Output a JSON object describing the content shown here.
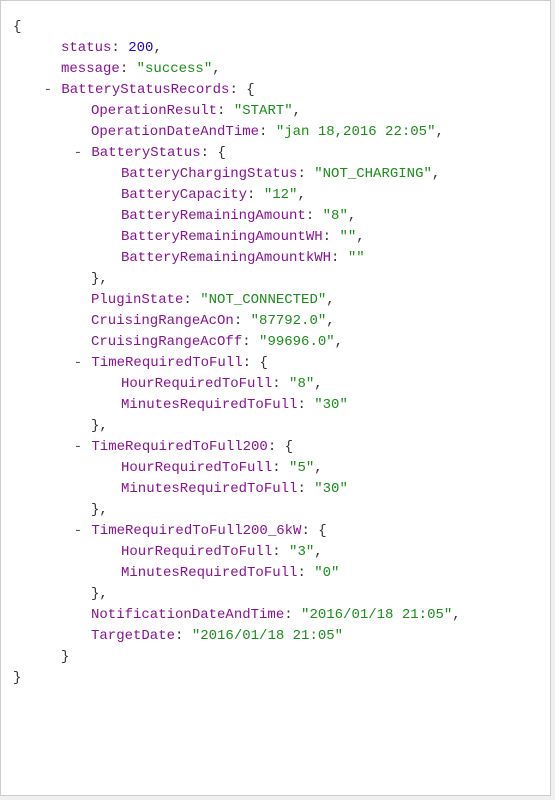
{
  "root": {
    "open": "{",
    "close": "}",
    "status_key": "status",
    "status_val": "200",
    "message_key": "message",
    "message_val": "\"success\"",
    "bsr_key": "BatteryStatusRecords",
    "bsr_open": "{",
    "op_result_key": "OperationResult",
    "op_result_val": "\"START\"",
    "op_dt_key": "OperationDateAndTime",
    "op_dt_val": "\"jan 18,2016 22:05\"",
    "bs_key": "BatteryStatus",
    "bs_open": "{",
    "bcs_key": "BatteryChargingStatus",
    "bcs_val": "\"NOT_CHARGING\"",
    "bcap_key": "BatteryCapacity",
    "bcap_val": "\"12\"",
    "bra_key": "BatteryRemainingAmount",
    "bra_val": "\"8\"",
    "brawh_key": "BatteryRemainingAmountWH",
    "brawh_val": "\"\"",
    "brakwh_key": "BatteryRemainingAmountkWH",
    "brakwh_val": "\"\"",
    "bs_close": "},",
    "plugin_key": "PluginState",
    "plugin_val": "\"NOT_CONNECTED\"",
    "cron_key": "CruisingRangeAcOn",
    "cron_val": "\"87792.0\"",
    "croff_key": "CruisingRangeAcOff",
    "croff_val": "\"99696.0\"",
    "trf_key": "TimeRequiredToFull",
    "trf_open": "{",
    "hrf_key": "HourRequiredToFull",
    "trf_h_val": "\"8\"",
    "mrf_key": "MinutesRequiredToFull",
    "trf_m_val": "\"30\"",
    "trf_close": "},",
    "trf200_key": "TimeRequiredToFull200",
    "trf200_h_val": "\"5\"",
    "trf200_m_val": "\"30\"",
    "trf6kw_key": "TimeRequiredToFull200_6kW",
    "trf6kw_h_val": "\"3\"",
    "trf6kw_m_val": "\"0\"",
    "notif_key": "NotificationDateAndTime",
    "notif_val": "\"2016/01/18 21:05\"",
    "target_key": "TargetDate",
    "target_val": "\"2016/01/18 21:05\"",
    "bsr_close": "}",
    "toggle": "-"
  }
}
